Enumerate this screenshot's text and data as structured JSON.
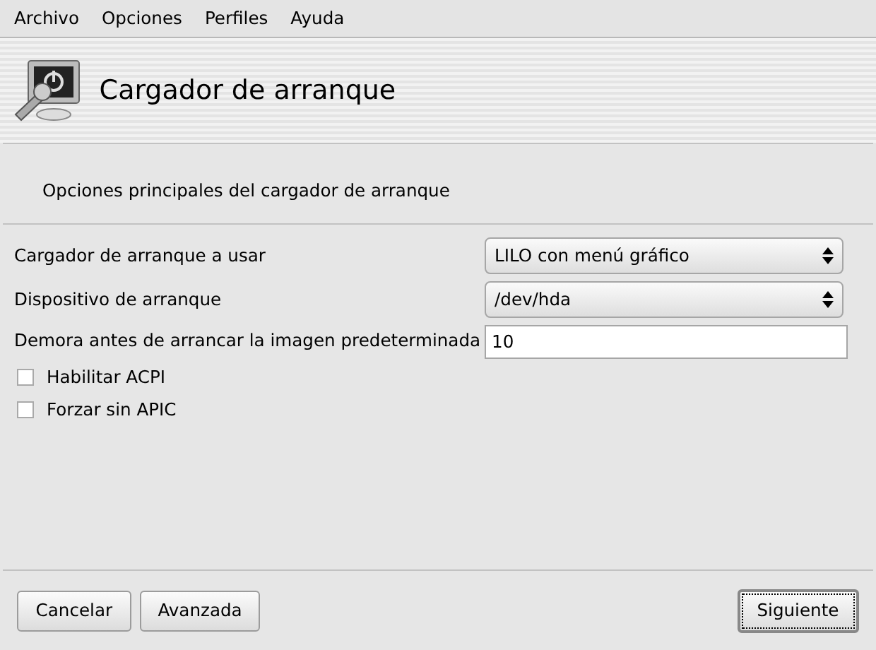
{
  "menu": [
    "Archivo",
    "Opciones",
    "Perfiles",
    "Ayuda"
  ],
  "header": {
    "title": "Cargador de arranque"
  },
  "description": "Opciones principales del cargador de arranque",
  "fields": [
    {
      "kind": "select",
      "label": "Cargador de arranque a usar",
      "value": "LILO con menú gráfico"
    },
    {
      "kind": "select",
      "label": "Dispositivo de arranque",
      "value": "/dev/hda"
    },
    {
      "kind": "text",
      "label": "Demora antes de arrancar la imagen predeterminada",
      "value": "10"
    },
    {
      "kind": "checkbox",
      "label": "Habilitar ACPI",
      "checked": false
    },
    {
      "kind": "checkbox",
      "label": "Forzar sin APIC",
      "checked": false
    }
  ],
  "buttons": [
    {
      "label": "Cancelar",
      "default": false
    },
    {
      "label": "Avanzada",
      "default": false
    },
    {
      "label": "Siguiente",
      "default": true
    }
  ]
}
